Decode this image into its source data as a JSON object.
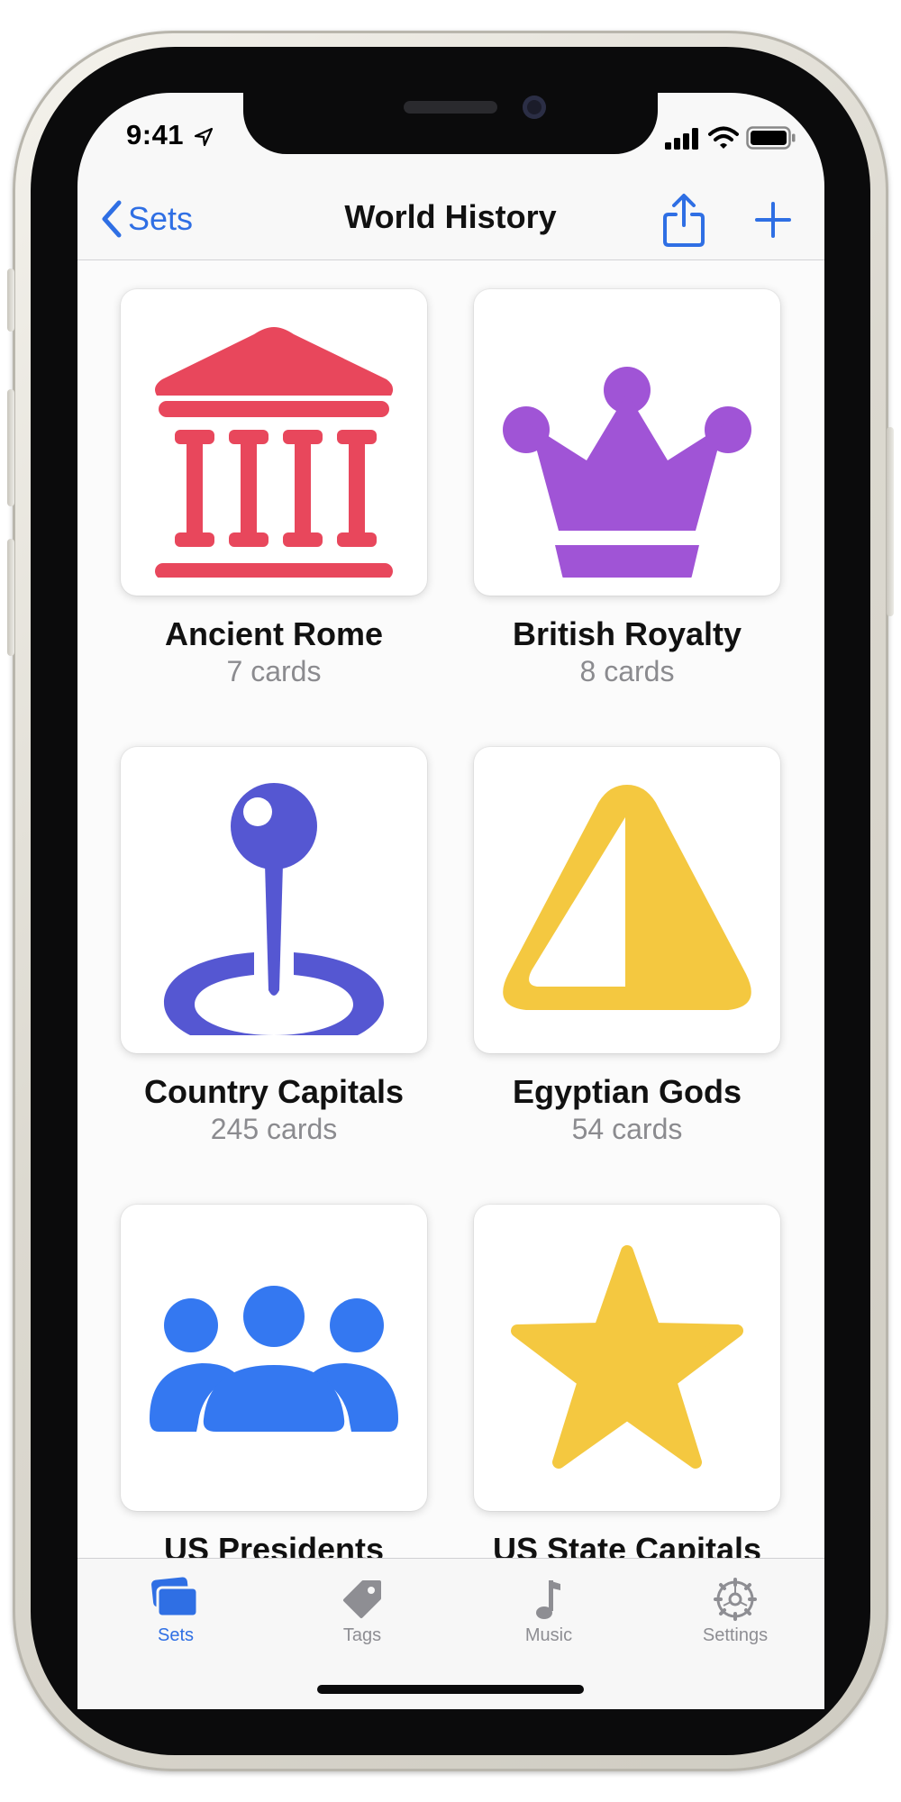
{
  "status_bar": {
    "time": "9:41"
  },
  "nav": {
    "back_label": "Sets",
    "title": "World History"
  },
  "sets": [
    {
      "name": "Ancient Rome",
      "count": "7 cards",
      "icon": "building-columns-icon",
      "color": "#e8475c"
    },
    {
      "name": "British Royalty",
      "count": "8 cards",
      "icon": "crown-icon",
      "color": "#a054d6"
    },
    {
      "name": "Country Capitals",
      "count": "245 cards",
      "icon": "map-pin-icon",
      "color": "#5557d2"
    },
    {
      "name": "Egyptian Gods",
      "count": "54 cards",
      "icon": "triangle-icon",
      "color": "#f4c840"
    },
    {
      "name": "US Presidents",
      "icon": "people-icon",
      "color": "#3478f1"
    },
    {
      "name": "US State Capitals",
      "icon": "star-icon",
      "color": "#f4c840"
    }
  ],
  "tabbar": {
    "active_color": "#2f6fe4",
    "inactive_color": "#8e8e93",
    "items": [
      {
        "label": "Sets",
        "icon": "cards-icon",
        "active": true
      },
      {
        "label": "Tags",
        "icon": "tag-icon",
        "active": false
      },
      {
        "label": "Music",
        "icon": "music-note-icon",
        "active": false
      },
      {
        "label": "Settings",
        "icon": "gear-icon",
        "active": false
      }
    ]
  }
}
